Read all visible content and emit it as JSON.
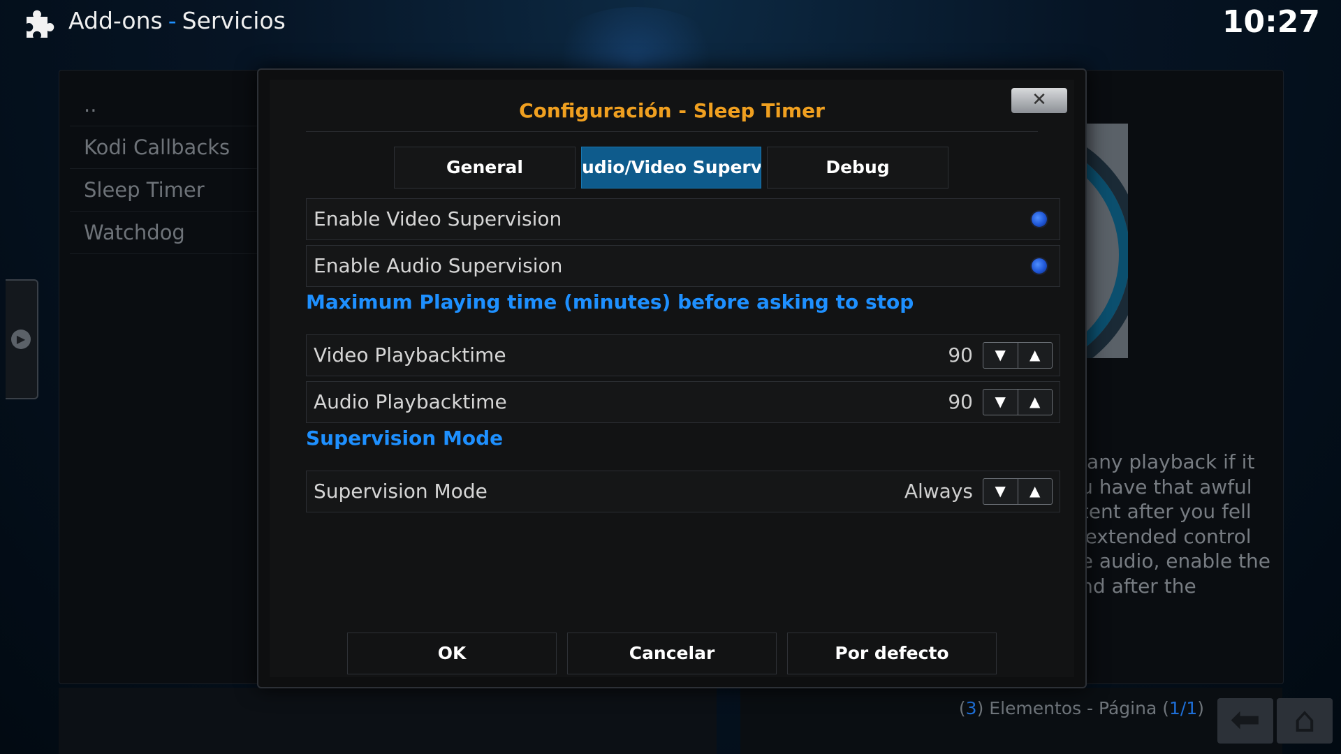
{
  "header": {
    "title": "Add-ons",
    "separator": "-",
    "subtitle": "Servicios",
    "clock": "10:27",
    "logo_icon": "puzzle-icon"
  },
  "background": {
    "list_items": [
      "..",
      "Kodi Callbacks",
      "Sleep Timer",
      "Watchdog"
    ],
    "description_lines": [
      "o any playback if it",
      "ou have that awful",
      "ntent after you fell",
      "s extended control",
      "he audio, enable the",
      "and after the"
    ],
    "footer": {
      "count_open": "(",
      "count": "3",
      "count_close": ")",
      "middle": "Elementos - Página",
      "page_open": "(",
      "page": "1/1",
      "page_close": ")"
    }
  },
  "dialog": {
    "title": "Configuración - Sleep Timer",
    "close_glyph": "✕",
    "tabs": [
      {
        "label": "General"
      },
      {
        "label": "udio/Video Supervis"
      },
      {
        "label": "Debug"
      }
    ],
    "settings": {
      "enable_video": {
        "label": "Enable Video Supervision",
        "on": true
      },
      "enable_audio": {
        "label": "Enable Audio Supervision",
        "on": true
      },
      "section_playtime": "Maximum Playing time (minutes) before asking to stop",
      "video_playback": {
        "label": "Video Playbacktime",
        "value": "90"
      },
      "audio_playback": {
        "label": "Audio Playbacktime",
        "value": "90"
      },
      "section_mode": "Supervision Mode",
      "supervision_mode": {
        "label": "Supervision Mode",
        "value": "Always"
      }
    },
    "spinner": {
      "down": "▼",
      "up": "▲"
    },
    "buttons": {
      "ok": "OK",
      "cancel": "Cancelar",
      "default": "Por defecto"
    }
  },
  "colors": {
    "accent_blue": "#1e90ff",
    "title_orange": "#f0a020",
    "active_tab": "#0e5b8c"
  }
}
